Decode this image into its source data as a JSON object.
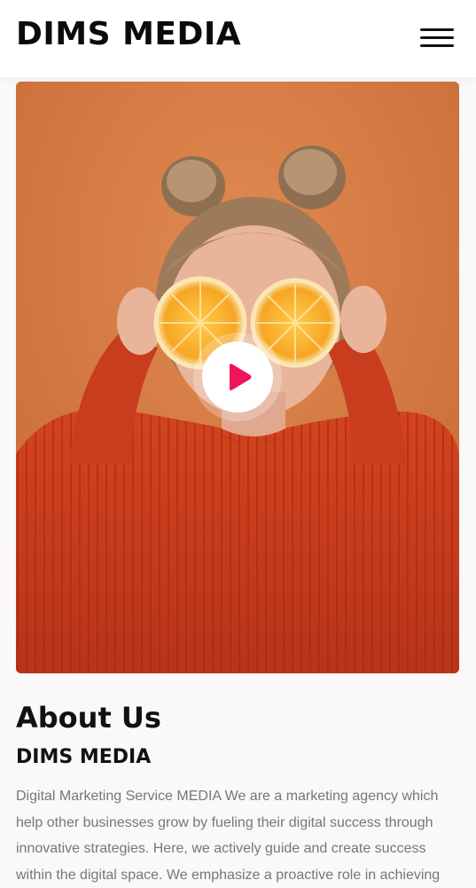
{
  "header": {
    "logo": "DIMS MEDIA",
    "menu_icon": "hamburger-menu-icon"
  },
  "hero": {
    "image_description_icon": "photo",
    "play_icon": "play-icon",
    "play_color": "#f0145a"
  },
  "about": {
    "title": "About Us",
    "subtitle": "DIMS MEDIA",
    "body": "Digital Marketing Service MEDIA We are a marketing agency which help other businesses grow by fueling their digital success through innovative strategies. Here, we actively guide and create success within the digital space. We emphasize a proactive role in achieving"
  },
  "colors": {
    "background": "#faf8f8",
    "header_bg": "#ffffff",
    "hero_orange": "#d0743f",
    "sweater_red": "#c63a1c",
    "text_dark": "#111111",
    "text_muted": "#777777"
  }
}
